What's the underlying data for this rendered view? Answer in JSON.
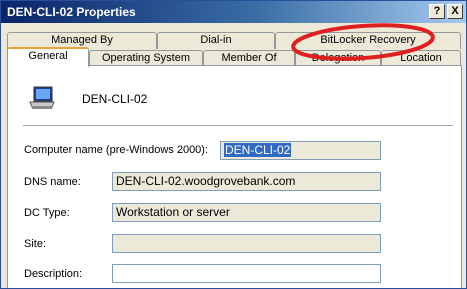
{
  "window": {
    "title": "DEN-CLI-02 Properties",
    "help_button": "?",
    "close_button": "X"
  },
  "tabs": {
    "row_back": [
      {
        "label": "Managed By"
      },
      {
        "label": "Dial-in"
      },
      {
        "label": "BitLocker Recovery"
      }
    ],
    "row_front": [
      {
        "label": "General"
      },
      {
        "label": "Operating System"
      },
      {
        "label": "Member Of"
      },
      {
        "label": "Delegation"
      },
      {
        "label": "Location"
      }
    ],
    "selected": "General"
  },
  "general": {
    "object_name": "DEN-CLI-02",
    "computer_name_label": "Computer name (pre-Windows 2000):",
    "computer_name_value": "DEN-CLI-02",
    "dns_label": "DNS name:",
    "dns_value": "DEN-CLI-02.woodgrovebank.com",
    "dc_type_label": "DC Type:",
    "dc_type_value": "Workstation or server",
    "site_label": "Site:",
    "site_value": "",
    "description_label": "Description:",
    "description_value": ""
  },
  "colors": {
    "annotation_ellipse": "#e02020",
    "selection": "#316ac5",
    "title_bar": "#0a246a"
  },
  "icons": {
    "object_icon": "computer-icon"
  }
}
